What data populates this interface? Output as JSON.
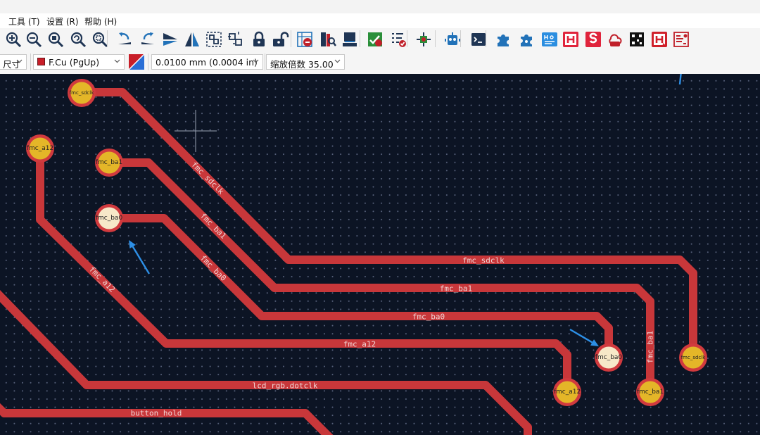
{
  "menus": [
    "工具 (T)",
    "设置 (R)",
    "帮助 (H)"
  ],
  "toolbar_buttons": [
    {
      "icon": "zoom-in-icon",
      "color": "#1f3554"
    },
    {
      "icon": "zoom-out-icon",
      "color": "#1f3554"
    },
    {
      "icon": "zoom-fit-icon",
      "color": "#1f3554"
    },
    {
      "icon": "zoom-refresh-icon",
      "color": "#1f3554"
    },
    {
      "icon": "zoom-selection-icon",
      "color": "#1f3554"
    },
    {
      "icon": "rotate-ccw-icon",
      "color": "#1f3554"
    },
    {
      "icon": "rotate-cw-icon",
      "color": "#1f3554"
    },
    {
      "icon": "mirror-vertical-icon",
      "color": "#1f3554"
    },
    {
      "icon": "mirror-horizontal-icon",
      "color": "#1f3554"
    },
    {
      "icon": "group-icon",
      "color": "#1f3554"
    },
    {
      "icon": "ungroup-icon",
      "color": "#1f3554"
    },
    {
      "icon": "lock-icon",
      "color": "#1f3554"
    },
    {
      "icon": "unlock-icon",
      "color": "#1f3554"
    },
    {
      "icon": "netlist-icon",
      "color": "#1f3554"
    },
    {
      "icon": "footprint-library-icon",
      "color": "#1f3554"
    },
    {
      "icon": "footprint-editor-icon",
      "color": "#1f3554"
    },
    {
      "icon": "drc-icon",
      "color": "#2a8f3a"
    },
    {
      "icon": "checklist-icon",
      "color": "#c0202a"
    },
    {
      "icon": "schematic-icon",
      "color": "#c0202a"
    },
    {
      "icon": "robot-icon",
      "color": "#2272b8"
    },
    {
      "icon": "terminal-icon",
      "color": "#1f3554"
    },
    {
      "icon": "plugin-icon",
      "color": "#2272b8"
    },
    {
      "icon": "plugin-manager-icon",
      "color": "#2272b8"
    },
    {
      "icon": "hq-dfm-icon",
      "color": "#2b8ee0"
    },
    {
      "icon": "h-icon",
      "color": "#e0243c"
    },
    {
      "icon": "s-icon",
      "color": "#e0243c"
    },
    {
      "icon": "cloud-lib-icon",
      "color": "#c0202a"
    },
    {
      "icon": "qr-icon",
      "color": "#111111"
    },
    {
      "icon": "h-red-icon",
      "color": "#d0202a"
    },
    {
      "icon": "pcb-plugin-icon",
      "color": "#c0202a"
    }
  ],
  "options": {
    "left_label": "尺寸",
    "layer": "F.Cu (PgUp)",
    "layer_color": "#c81e28",
    "grid": "0.0100 mm (0.0004 in)",
    "zoom": "缩放倍数 35.00"
  },
  "canvas": {
    "pads": [
      {
        "label": "fmc_sdclk",
        "color": "#e4b628"
      },
      {
        "label": "fmc_a12",
        "color": "#e4b628"
      },
      {
        "label": "fmc_ba1",
        "color": "#e4b628"
      },
      {
        "label": "fmc_ba0",
        "color": "#f7e8c8"
      },
      {
        "label": "fmc_ba0",
        "color": "#f7e8c8"
      },
      {
        "label": "fmc_a12",
        "color": "#e4b628"
      },
      {
        "label": "fmc_ba1",
        "color": "#e4b628"
      },
      {
        "label": "fmc_sdclk",
        "color": "#e4b628"
      }
    ],
    "track_labels": [
      "fmc_sdclk",
      "fmc_ba1",
      "fmc_ba0",
      "fmc_a12",
      "fmc_sdclk",
      "fmc_ba1",
      "fmc_ba0",
      "fmc_a12",
      "lcd_rgb.dotclk",
      "button_hold",
      "fmc_ba1"
    ],
    "colors": {
      "track": "#c8373a",
      "background": "#0c1424",
      "annotation_arrow": "#2d8fe6"
    }
  }
}
